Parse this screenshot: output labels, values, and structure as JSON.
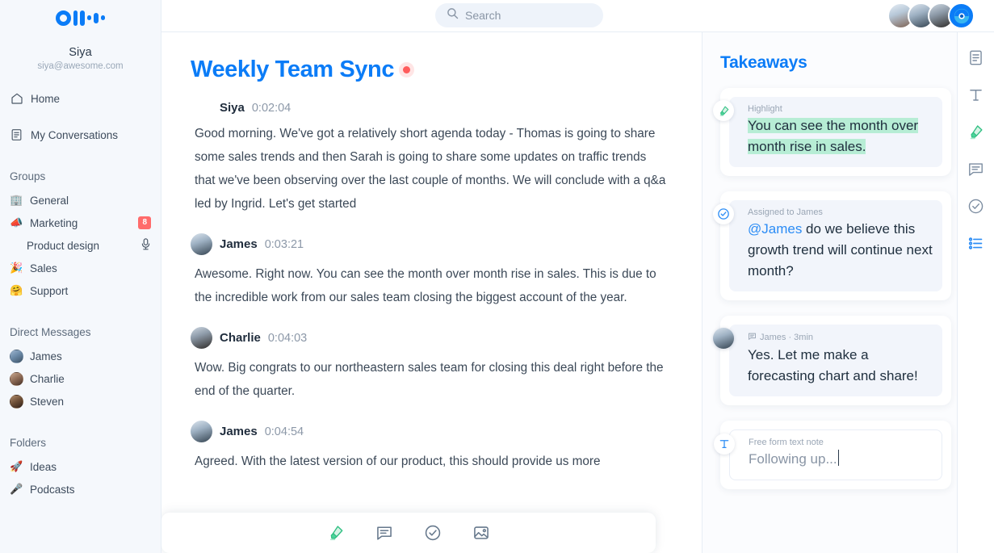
{
  "brand": {
    "logo_name": "otter-logo",
    "accent": "#0b7cf7"
  },
  "sidebar": {
    "user": {
      "name": "Siya",
      "email": "siya@awesome.com"
    },
    "nav": [
      {
        "label": "Home",
        "icon": "home-icon"
      },
      {
        "label": "My Conversations",
        "icon": "conversations-icon"
      }
    ],
    "groups_title": "Groups",
    "groups": [
      {
        "label": "General",
        "emoji": "🏢",
        "badge": ""
      },
      {
        "label": "Marketing",
        "emoji": "📣",
        "badge": "8"
      },
      {
        "label": "Product design",
        "emoji": "",
        "badge": "",
        "sub": true,
        "mic": true
      },
      {
        "label": "Sales",
        "emoji": "🎉",
        "badge": ""
      },
      {
        "label": "Support",
        "emoji": "🤗",
        "badge": ""
      }
    ],
    "dm_title": "Direct Messages",
    "dms": [
      {
        "label": "James"
      },
      {
        "label": "Charlie"
      },
      {
        "label": "Steven"
      }
    ],
    "folders_title": "Folders",
    "folders": [
      {
        "label": "Ideas",
        "emoji": "🚀"
      },
      {
        "label": "Podcasts",
        "emoji": "🎤"
      }
    ]
  },
  "topbar": {
    "search": {
      "placeholder": "Search",
      "value": "",
      "icon": "search-icon"
    },
    "avatars": [
      {
        "name": "avatar-participant-1"
      },
      {
        "name": "avatar-participant-2"
      },
      {
        "name": "avatar-participant-3"
      },
      {
        "name": "record-button",
        "record": true
      }
    ]
  },
  "transcript": {
    "title": "Weekly Team Sync",
    "recording": true,
    "messages": [
      {
        "speaker": "Siya",
        "time": "0:02:04",
        "avatar": false,
        "text": "Good morning. We've got a relatively short agenda today - Thomas is going to share some sales trends and then Sarah is going to share some updates on traffic trends that we've been observing over the last couple of months. We will conclude with a q&a led by Ingrid. Let's get started"
      },
      {
        "speaker": "James",
        "time": "0:03:21",
        "avatar": true,
        "text": "Awesome. Right now. You can see the month over month rise in sales. This is due to the incredible work from our sales team closing the biggest account of the year."
      },
      {
        "speaker": "Charlie",
        "time": "0:04:03",
        "avatar": true,
        "text": "Wow. Big congrats to our northeastern sales team for closing this deal right before the end of the quarter."
      },
      {
        "speaker": "James",
        "time": "0:04:54",
        "avatar": true,
        "text": "Agreed. With the latest version of our product, this should provide us more"
      }
    ],
    "compose_tools": [
      {
        "name": "highlight-tool"
      },
      {
        "name": "comment-tool"
      },
      {
        "name": "action-item-tool"
      },
      {
        "name": "image-tool"
      }
    ]
  },
  "takeaways": {
    "title": "Takeaways",
    "cards": [
      {
        "kind": "highlight",
        "icon": "highlighter-icon",
        "meta": "Highlight",
        "line1": "You can see the month over",
        "line2": "month rise in sales."
      },
      {
        "kind": "action",
        "icon": "check-circle-icon",
        "meta": "Assigned to James",
        "mention": "@James",
        "text": " do we believe this growth trend will continue next month?"
      },
      {
        "kind": "comment",
        "icon": "comment-icon",
        "meta": "James · 3min",
        "line1": "Yes. Let me make a",
        "line2": "forecasting chart and share!"
      },
      {
        "kind": "note",
        "icon": "text-note-icon",
        "meta": "Free form text note",
        "text": "Following up..."
      }
    ]
  },
  "rail": {
    "items": [
      {
        "name": "transcript-panel-icon",
        "active": false
      },
      {
        "name": "text-note-panel-icon",
        "active": false
      },
      {
        "name": "highlight-panel-icon",
        "active": false
      },
      {
        "name": "comment-panel-icon",
        "active": false
      },
      {
        "name": "action-item-panel-icon",
        "active": false
      },
      {
        "name": "takeaways-panel-icon",
        "active": true
      }
    ]
  }
}
